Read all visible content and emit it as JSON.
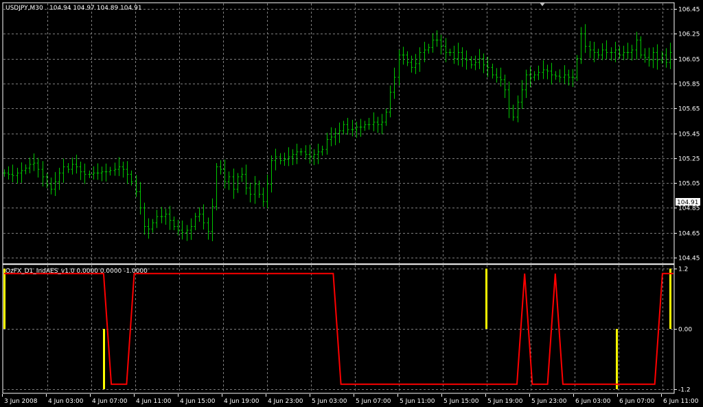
{
  "main_chart": {
    "symbol_label": "USDJPY,M30",
    "ohlc_label": "104.94 104.97 104.89 104.91",
    "price_ticks": [
      "106.45",
      "106.25",
      "106.05",
      "105.85",
      "105.65",
      "105.45",
      "105.25",
      "105.05",
      "104.85",
      "104.65",
      "104.45"
    ],
    "current_price": "104.91",
    "bar_color": "#00c800",
    "grid_color": "#7f7f7f"
  },
  "indicator": {
    "label": "OzFX_D1_IndAES_v1.0 0.0000 0.0000 -1.0000",
    "level_ticks": [
      "1.2",
      "0.00",
      "-1.2"
    ],
    "line_color": "#ff0000",
    "histogram_color": "#ffff00"
  },
  "time_axis": {
    "labels": [
      "3 Jun 2008",
      "4 Jun 03:00",
      "4 Jun 07:00",
      "4 Jun 11:00",
      "4 Jun 15:00",
      "4 Jun 19:00",
      "4 Jun 23:00",
      "5 Jun 03:00",
      "5 Jun 07:00",
      "5 Jun 11:00",
      "5 Jun 15:00",
      "5 Jun 19:00",
      "5 Jun 23:00",
      "6 Jun 03:00",
      "6 Jun 07:00",
      "6 Jun 11:00"
    ]
  },
  "chart_data": [
    {
      "type": "line",
      "series": [
        {
          "values": [
            105.13,
            105.12,
            105.11,
            105.13,
            105.15,
            105.17,
            105.2,
            105.21,
            105.16,
            105.1,
            105.04,
            105.0,
            105.06,
            105.13,
            105.18,
            105.16,
            105.2,
            105.18,
            105.14,
            105.12,
            105.12,
            105.13,
            105.13,
            105.14,
            105.14,
            105.15,
            105.16,
            105.18,
            105.16,
            105.12,
            105.06,
            104.98,
            104.85,
            104.7,
            104.68,
            104.73,
            104.78,
            104.78,
            104.8,
            104.75,
            104.7,
            104.67,
            104.65,
            104.67,
            104.7,
            104.78,
            104.8,
            104.73,
            104.66,
            104.86,
            105.18,
            105.16,
            105.06,
            105.1,
            105.0,
            105.1,
            105.12,
            105.01,
            104.96,
            105.04,
            104.96,
            104.9,
            105.04,
            105.23,
            105.26,
            105.23,
            105.24,
            105.26,
            105.28,
            105.3,
            105.3,
            105.28,
            105.26,
            105.28,
            105.3,
            105.32,
            105.4,
            105.42,
            105.45,
            105.47,
            105.52,
            105.48,
            105.48,
            105.5,
            105.5,
            105.52,
            105.52,
            105.54,
            105.52,
            105.54,
            105.62,
            105.78,
            105.9,
            106.08,
            106.08,
            106.02,
            105.98,
            106.01,
            106.1,
            106.12,
            106.14,
            106.2,
            106.2,
            106.15,
            106.1,
            106.1,
            106.05,
            106.1,
            106.05,
            106.04,
            106.0,
            106.02,
            106.05,
            106.0,
            105.98,
            105.92,
            105.9,
            105.88,
            105.8,
            105.65,
            105.58,
            105.7,
            105.8,
            105.92,
            105.9,
            105.92,
            105.94,
            105.96,
            105.95,
            105.92,
            105.91,
            105.9,
            105.92,
            105.9,
            105.9,
            106.05,
            106.25,
            106.15,
            106.12,
            106.1,
            106.08,
            106.12,
            106.1,
            106.1,
            106.12,
            106.08,
            106.1,
            106.1,
            106.12,
            106.2,
            106.08,
            106.06,
            106.04,
            106.1,
            106.04,
            106.08,
            106.02,
            106.1
          ]
        }
      ],
      "x": [
        "3 Jun 2008",
        "4 Jun 03:00",
        "4 Jun 07:00",
        "4 Jun 11:00",
        "4 Jun 15:00",
        "4 Jun 19:00",
        "4 Jun 23:00",
        "5 Jun 03:00",
        "5 Jun 07:00",
        "5 Jun 11:00",
        "5 Jun 15:00",
        "5 Jun 19:00",
        "5 Jun 23:00",
        "6 Jun 03:00",
        "6 Jun 07:00",
        "6 Jun 11:00"
      ],
      "ylim": [
        104.4,
        106.5
      ],
      "grid": true
    },
    {
      "type": "line",
      "series": [
        {
          "values": [
            1.0,
            1.0,
            1.0,
            1.0,
            1.0,
            1.0,
            1.0,
            1.0,
            1.0,
            1.0,
            1.0,
            1.0,
            1.0,
            1.0,
            -1.0,
            -1.0,
            -1.0,
            1.0,
            1.0,
            1.0,
            1.0,
            1.0,
            1.0,
            1.0,
            1.0,
            1.0,
            1.0,
            1.0,
            1.0,
            1.0,
            1.0,
            1.0,
            1.0,
            1.0,
            1.0,
            1.0,
            1.0,
            1.0,
            1.0,
            1.0,
            1.0,
            1.0,
            1.0,
            1.0,
            -1.0,
            -1.0,
            -1.0,
            -1.0,
            -1.0,
            -1.0,
            -1.0,
            -1.0,
            -1.0,
            -1.0,
            -1.0,
            -1.0,
            -1.0,
            -1.0,
            -1.0,
            -1.0,
            -1.0,
            -1.0,
            -1.0,
            -1.0,
            -1.0,
            -1.0,
            -1.0,
            -1.0,
            1.0,
            -1.0,
            -1.0,
            -1.0,
            1.0,
            -1.0,
            -1.0,
            -1.0,
            -1.0,
            -1.0,
            -1.0,
            -1.0,
            -1.0,
            -1.0,
            -1.0,
            -1.0,
            -1.0,
            -1.0,
            1.0,
            1.0
          ]
        },
        {
          "values": [
            1.2,
            0,
            0,
            0,
            0,
            0,
            0,
            0,
            0,
            0,
            0,
            0,
            0,
            -1.2,
            0,
            0,
            0,
            0,
            0,
            0,
            0,
            0,
            0,
            0,
            0,
            0,
            0,
            0,
            0,
            0,
            0,
            0,
            0,
            0,
            0,
            0,
            0,
            0,
            0,
            0,
            0,
            0,
            0,
            0,
            0,
            0,
            0,
            0,
            0,
            0,
            0,
            0,
            0,
            0,
            0,
            0,
            0,
            0,
            0,
            0,
            0,
            0,
            0,
            1.2,
            0,
            0,
            0,
            0,
            0,
            0,
            0,
            0,
            0,
            0,
            0,
            0,
            0,
            0,
            0,
            0,
            -1.2,
            0,
            0,
            0,
            0,
            0,
            0,
            1.2
          ]
        }
      ],
      "ylim": [
        -1.2,
        1.2
      ],
      "grid": true
    }
  ]
}
